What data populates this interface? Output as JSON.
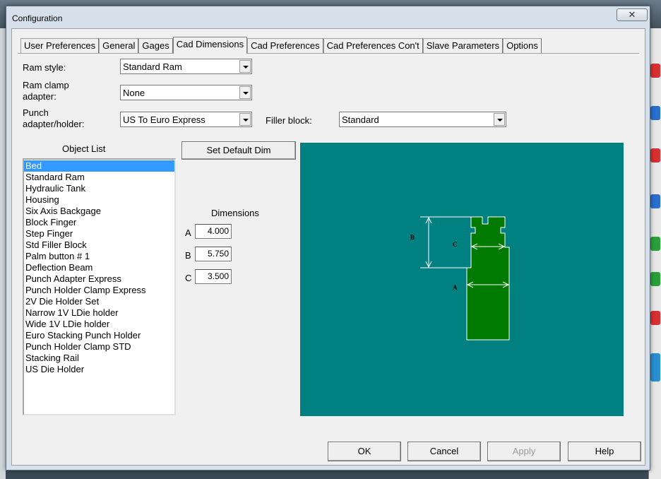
{
  "window": {
    "title": "Configuration",
    "close_glyph": "✕"
  },
  "tabs": [
    {
      "label": "User Preferences"
    },
    {
      "label": "General"
    },
    {
      "label": "Gages"
    },
    {
      "label": "Cad Dimensions",
      "active": true
    },
    {
      "label": "Cad Preferences"
    },
    {
      "label": "Cad Preferences Con't"
    },
    {
      "label": "Slave Parameters"
    },
    {
      "label": "Options"
    }
  ],
  "form": {
    "ram_style": {
      "label": "Ram style:",
      "value": "Standard Ram"
    },
    "ram_clamp": {
      "label_line1": "Ram clamp",
      "label_line2": "adapter:",
      "value": "None"
    },
    "punch_adapter": {
      "label_line1": "Punch",
      "label_line2": "adapter/holder:",
      "value": "US To Euro Express"
    },
    "filler_block": {
      "label": "Filler block:",
      "value": "Standard"
    }
  },
  "object_list": {
    "title": "Object List",
    "selected": "Bed",
    "items": [
      "Bed",
      "Standard Ram",
      "Hydraulic Tank",
      "Housing",
      "Six Axis Backgage",
      "Block Finger",
      "Step Finger",
      "Std Filler Block",
      "Palm button # 1",
      "Deflection Beam",
      "Punch Adapter Express",
      "Punch Holder Clamp Express",
      "2V Die Holder Set",
      "Narrow 1V LDie holder",
      "Wide 1V LDie holder",
      "Euro Stacking Punch Holder",
      "Punch Holder Clamp STD",
      "Stacking Rail",
      "US Die Holder"
    ]
  },
  "set_default_button": "Set Default Dim",
  "dimensions": {
    "title": "Dimensions",
    "rows": [
      {
        "label": "A",
        "value": "4.000"
      },
      {
        "label": "B",
        "value": "5.750"
      },
      {
        "label": "C",
        "value": "3.500"
      }
    ]
  },
  "preview": {
    "background": "#008080",
    "shape_color": "#007a00",
    "labels": {
      "a": "A",
      "b": "B",
      "c": "C"
    }
  },
  "footer": {
    "ok": "OK",
    "cancel": "Cancel",
    "apply": "Apply",
    "help": "Help"
  }
}
